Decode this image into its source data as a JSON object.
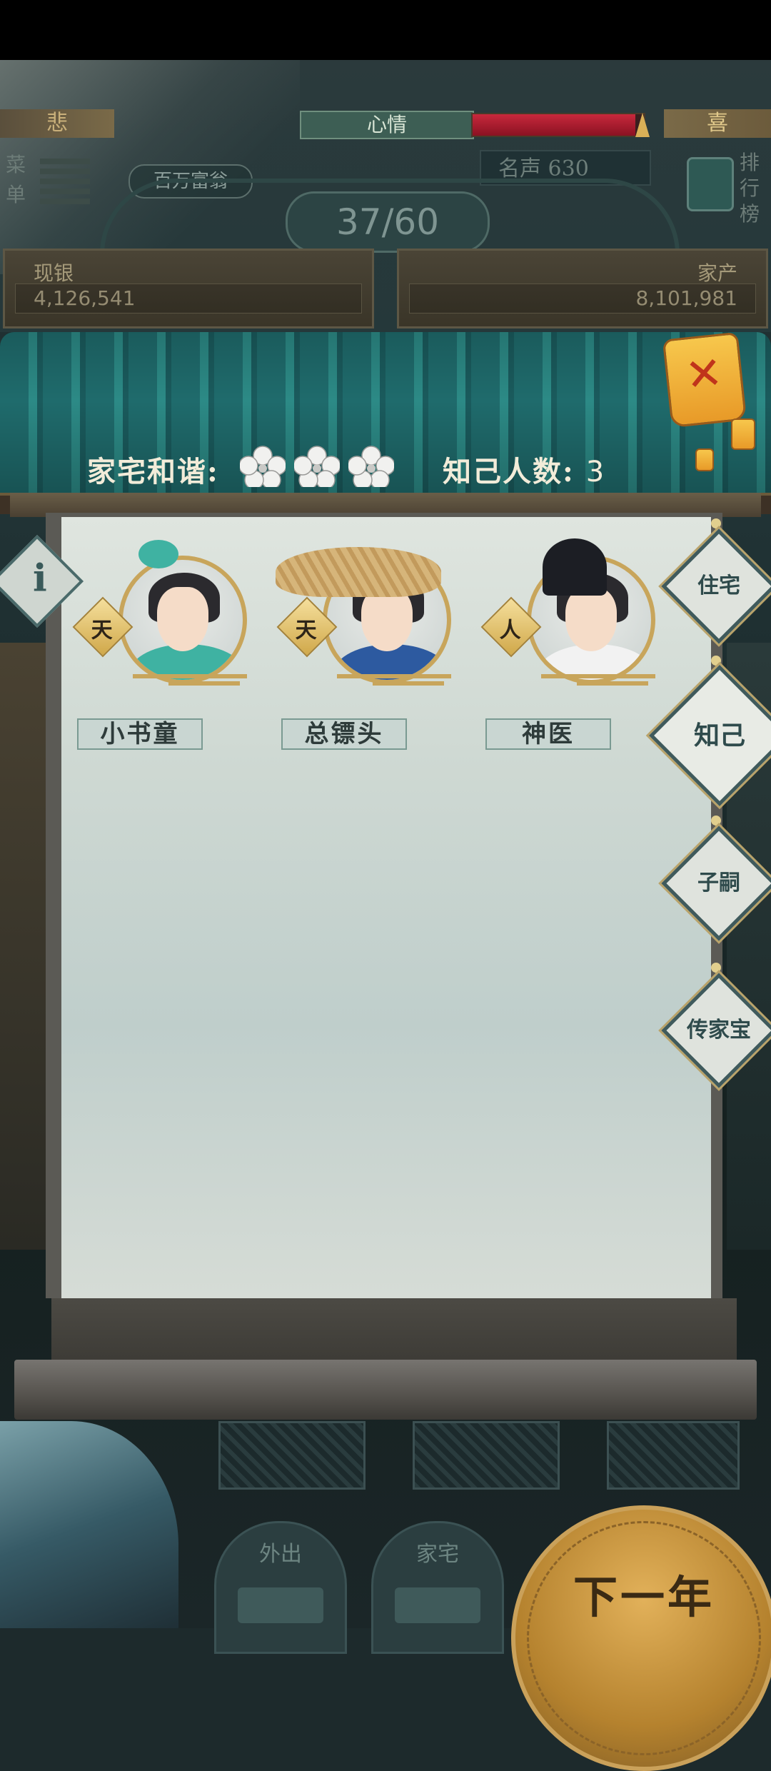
{
  "top_bar": {
    "mood_left_label": "悲",
    "mood_center_label": "心情",
    "mood_right_label": "喜",
    "mood_level": 0.95,
    "menu_label": "菜单",
    "title_badge": "百万富翁",
    "fame_text": "名声 630",
    "rank_label": "排行榜",
    "year_counter": "37/60"
  },
  "finance": {
    "silver_label": "现银",
    "silver_value": "4,126,541",
    "assets_label": "家产",
    "assets_value": "8,101,981"
  },
  "household": {
    "harmony_label": "家宅和谐:",
    "harmony_flowers": 3,
    "known_label": "知己人数:",
    "known_count": "3"
  },
  "characters": [
    {
      "rank": "天",
      "name": "小书童",
      "robe_color": "#3fb2a2"
    },
    {
      "rank": "天",
      "name": "总镖头",
      "robe_color": "#2d5aa0"
    },
    {
      "rank": "人",
      "name": "神医",
      "robe_color": "#f2f2f2"
    }
  ],
  "side_tabs": {
    "residence": "住宅",
    "confidants": "知己",
    "heirs": "子嗣",
    "heirloom": "传家宝"
  },
  "bottom_nav": {
    "go_out": "外出",
    "home": "家宅",
    "next_year": "下一年"
  },
  "colors": {
    "mood_fill": "#c8283c",
    "accent_gold": "#c8a55b",
    "roof_teal": "#1f6b6c"
  }
}
